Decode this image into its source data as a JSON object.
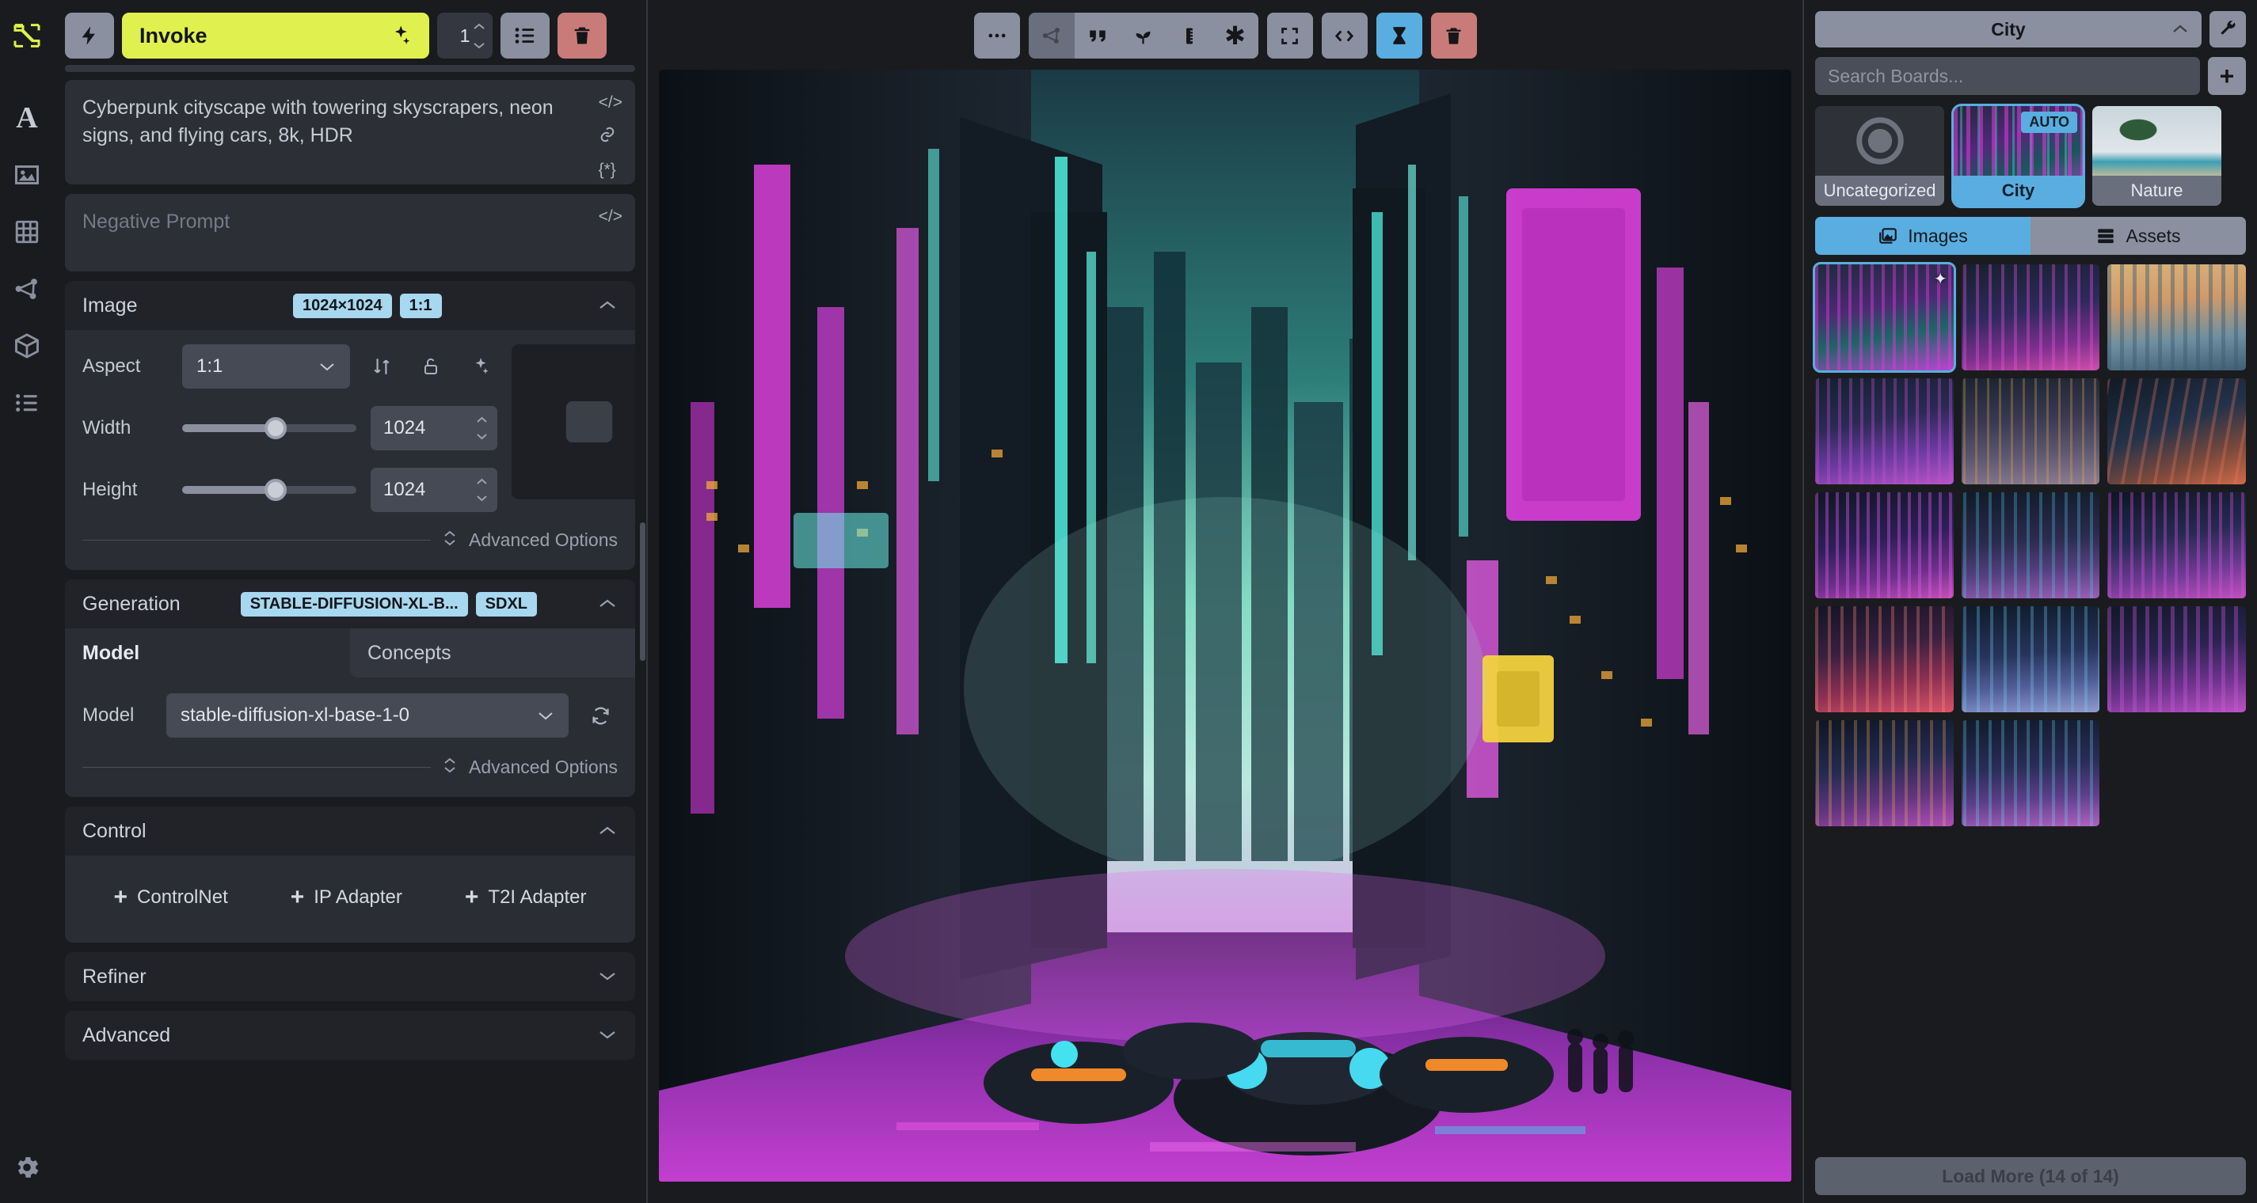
{
  "app": {
    "accent_yellow": "#e0f04f",
    "accent_blue": "#5aade0",
    "danger": "#c97b79"
  },
  "rail": {
    "items": [
      {
        "name": "logo-icon",
        "label": "Invoke"
      },
      {
        "name": "text-to-image-icon",
        "label": "A"
      },
      {
        "name": "image-icon",
        "label": "Image"
      },
      {
        "name": "grid-icon",
        "label": "Grid"
      },
      {
        "name": "nodes-icon",
        "label": "Nodes"
      },
      {
        "name": "model-cube-icon",
        "label": "Models"
      },
      {
        "name": "queue-list-icon",
        "label": "Queue"
      }
    ],
    "settings_label": "Settings"
  },
  "toolbar": {
    "bolt_label": "Invoke now",
    "invoke_label": "Invoke",
    "sparkle_icon": "sparkles",
    "iterations": "1",
    "queue_list_label": "Queue",
    "clear_queue_label": "Clear Queue"
  },
  "prompt": {
    "positive": "Cyberpunk cityscape with towering skyscrapers, neon signs, and flying cars, 8k, HDR",
    "negative_placeholder": "Negative Prompt",
    "icons": [
      "code-icon",
      "link-icon",
      "embedding-icon"
    ]
  },
  "image_section": {
    "title": "Image",
    "badges": [
      "1024×1024",
      "1:1"
    ],
    "aspect_label": "Aspect",
    "aspect_value": "1:1",
    "swap_icon": "swap-dimensions-icon",
    "lock_icon": "lock-aspect-icon",
    "sparkle_icon": "optimize-icon",
    "width_label": "Width",
    "width_value": "1024",
    "height_label": "Height",
    "height_value": "1024",
    "advanced_label": "Advanced Options"
  },
  "generation_section": {
    "title": "Generation",
    "badges": [
      "STABLE-DIFFUSION-XL-B...",
      "SDXL"
    ],
    "tabs": [
      {
        "label": "Model",
        "active": true
      },
      {
        "label": "Concepts",
        "active": false
      }
    ],
    "model_label": "Model",
    "model_value": "stable-diffusion-xl-base-1-0",
    "sync_icon": "sync-models-icon",
    "advanced_label": "Advanced Options"
  },
  "control_section": {
    "title": "Control",
    "buttons": [
      {
        "label": "ControlNet"
      },
      {
        "label": "IP Adapter"
      },
      {
        "label": "T2I Adapter"
      }
    ]
  },
  "refiner_section": {
    "title": "Refiner"
  },
  "advanced_section": {
    "title": "Advanced"
  },
  "canvas_toolbar": {
    "buttons": [
      {
        "name": "more-options-icon",
        "glyph": "•••",
        "style": "grey"
      },
      {
        "name": "send-to-node-icon",
        "glyph": "node",
        "style": "greyd"
      },
      {
        "name": "use-prompt-icon",
        "glyph": "”",
        "style": "grey"
      },
      {
        "name": "use-seed-icon",
        "glyph": "seedling",
        "style": "grey"
      },
      {
        "name": "use-size-icon",
        "glyph": "ruler",
        "style": "grey"
      },
      {
        "name": "use-all-icon",
        "glyph": "✱",
        "style": "grey"
      },
      {
        "name": "fullscreen-icon",
        "glyph": "expand",
        "style": "grey"
      },
      {
        "name": "metadata-code-icon",
        "glyph": "</>",
        "style": "grey"
      },
      {
        "name": "progress-hourglass-icon",
        "glyph": "hourglass",
        "style": "blue"
      },
      {
        "name": "delete-image-icon",
        "glyph": "trash",
        "style": "red"
      }
    ]
  },
  "gallery": {
    "board_selected": "City",
    "settings_icon": "wrench-icon",
    "search_placeholder": "Search Boards...",
    "add_board_label": "+",
    "boards": [
      {
        "label": "Uncategorized",
        "selected": false,
        "auto": false,
        "thumb": "ring"
      },
      {
        "label": "City",
        "selected": true,
        "auto": true,
        "auto_label": "AUTO",
        "thumb": "city"
      },
      {
        "label": "Nature",
        "selected": false,
        "auto": false,
        "thumb": "beach"
      }
    ],
    "tabs": [
      {
        "label": "Images",
        "icon": "images-icon",
        "active": true
      },
      {
        "label": "Assets",
        "icon": "assets-icon",
        "active": false
      }
    ],
    "images": [
      {
        "id": 1,
        "selected": true,
        "starred": true,
        "style": "c1"
      },
      {
        "id": 2,
        "selected": false,
        "starred": false,
        "style": "c2"
      },
      {
        "id": 3,
        "selected": false,
        "starred": false,
        "style": "c3"
      },
      {
        "id": 4,
        "selected": false,
        "starred": false,
        "style": "c4"
      },
      {
        "id": 5,
        "selected": false,
        "starred": false,
        "style": "c5"
      },
      {
        "id": 6,
        "selected": false,
        "starred": false,
        "style": "c6"
      },
      {
        "id": 7,
        "selected": false,
        "starred": false,
        "style": "c7"
      },
      {
        "id": 8,
        "selected": false,
        "starred": false,
        "style": "c8"
      },
      {
        "id": 9,
        "selected": false,
        "starred": false,
        "style": "c9"
      },
      {
        "id": 10,
        "selected": false,
        "starred": false,
        "style": "c10"
      },
      {
        "id": 11,
        "selected": false,
        "starred": false,
        "style": "c11"
      },
      {
        "id": 12,
        "selected": false,
        "starred": false,
        "style": "c12"
      },
      {
        "id": 13,
        "selected": false,
        "starred": false,
        "style": "c13"
      },
      {
        "id": 14,
        "selected": false,
        "starred": false,
        "style": "c14"
      }
    ],
    "load_more_label": "Load More (14 of 14)"
  },
  "canvas": {
    "alt": "Cyberpunk cityscape generated image"
  }
}
